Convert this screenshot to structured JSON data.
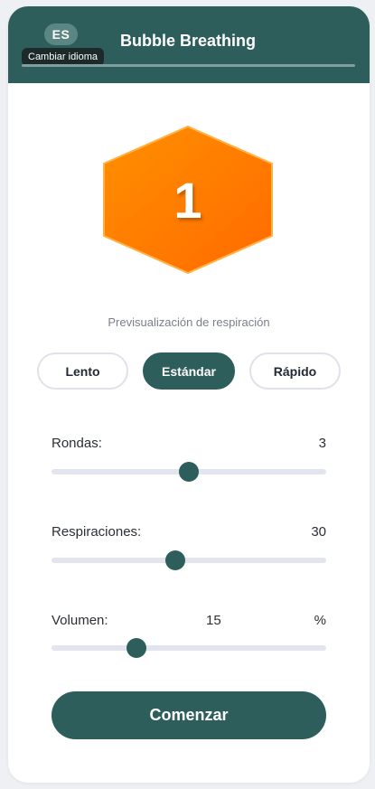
{
  "header": {
    "language_code": "ES",
    "language_tooltip": "Cambiar idioma",
    "title": "Bubble Breathing"
  },
  "preview": {
    "count": "1",
    "label": "Previsualización de respiración",
    "shape": "hexagon",
    "color_start": "#ff8c00",
    "color_end": "#ff6a00"
  },
  "speed": {
    "options": [
      "Lento",
      "Estándar",
      "Rápido"
    ],
    "selected": "Estándar"
  },
  "controls": {
    "rounds": {
      "label": "Rondas:",
      "value": "3",
      "level": 0.5
    },
    "breaths": {
      "label": "Respiraciones:",
      "value": "30",
      "level": 0.45
    },
    "volume": {
      "label": "Volumen:",
      "value": "15",
      "unit": "%",
      "level": 0.31
    }
  },
  "start_label": "Comenzar",
  "colors": {
    "primary": "#2d5e5c",
    "track": "#e2e5ee"
  }
}
